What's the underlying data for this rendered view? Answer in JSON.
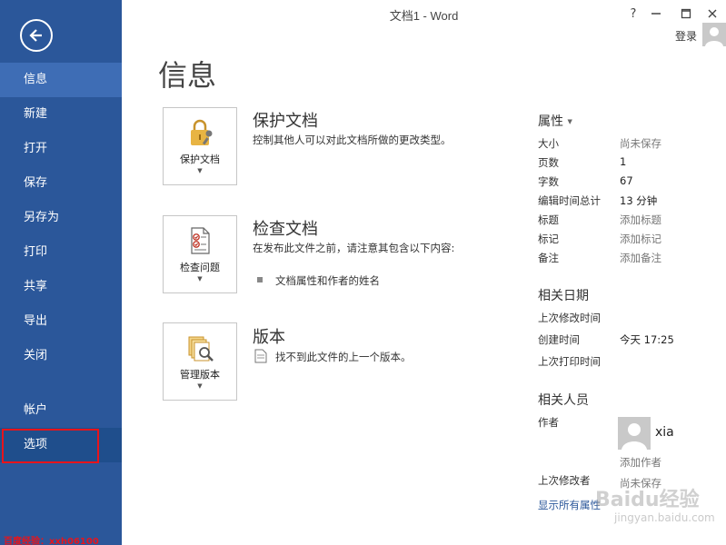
{
  "window": {
    "title": "文档1 - Word",
    "help": "?",
    "login": "登录"
  },
  "nav": {
    "items": [
      {
        "label": "信息"
      },
      {
        "label": "新建"
      },
      {
        "label": "打开"
      },
      {
        "label": "保存"
      },
      {
        "label": "另存为"
      },
      {
        "label": "打印"
      },
      {
        "label": "共享"
      },
      {
        "label": "导出"
      },
      {
        "label": "关闭"
      },
      {
        "label": "帐户"
      },
      {
        "label": "选项"
      }
    ],
    "watermark": "百度经验：xxh06100"
  },
  "main": {
    "title": "信息",
    "protect": {
      "button": "保护文档",
      "title": "保护文档",
      "desc": "控制其他人可以对此文档所做的更改类型。"
    },
    "inspect": {
      "button": "检查问题",
      "title": "检查文档",
      "desc": "在发布此文件之前，请注意其包含以下内容:",
      "bullet": "文档属性和作者的姓名"
    },
    "version": {
      "button": "管理版本",
      "title": "版本",
      "desc": "找不到此文件的上一个版本。"
    }
  },
  "props": {
    "header": "属性",
    "rows": [
      {
        "label": "大小",
        "value": "尚未保存"
      },
      {
        "label": "页数",
        "value": "1"
      },
      {
        "label": "字数",
        "value": "67"
      },
      {
        "label": "编辑时间总计",
        "value": "13 分钟"
      },
      {
        "label": "标题",
        "value": "添加标题"
      },
      {
        "label": "标记",
        "value": "添加标记"
      },
      {
        "label": "备注",
        "value": "添加备注"
      }
    ],
    "dates_header": "相关日期",
    "dates": [
      {
        "label": "上次修改时间",
        "value": ""
      },
      {
        "label": "创建时间",
        "value": "今天 17:25"
      },
      {
        "label": "上次打印时间",
        "value": ""
      }
    ],
    "people_header": "相关人员",
    "author_label": "作者",
    "author_name": "xia",
    "add_author": "添加作者",
    "last_modified_by_label": "上次修改者",
    "last_modified_by_value": "尚未保存",
    "show_all": "显示所有属性",
    "watermark_brand": "Baidu经验",
    "watermark_url": "jingyan.baidu.com"
  }
}
